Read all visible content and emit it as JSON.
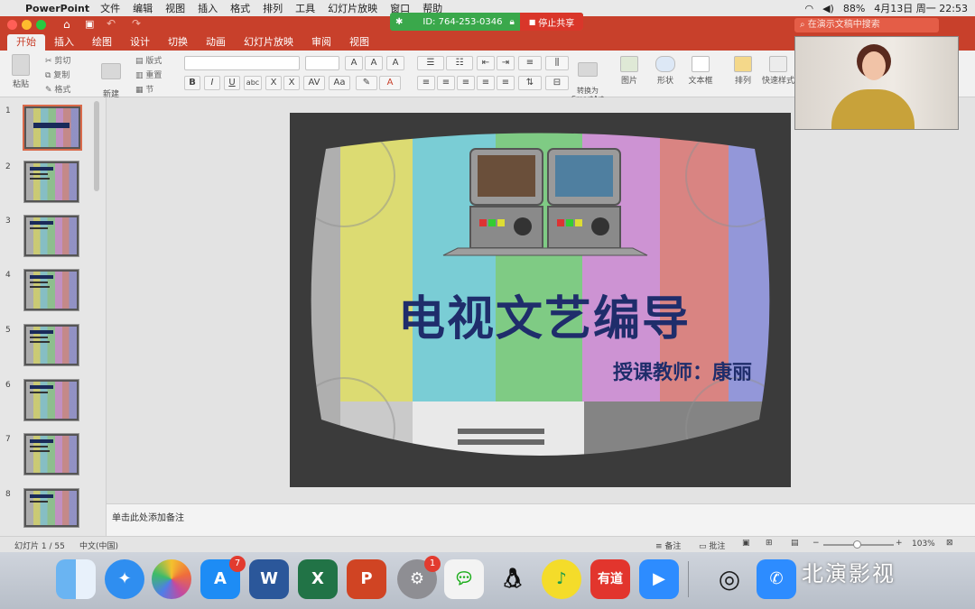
{
  "menubar": {
    "app_name": "PowerPoint",
    "items": [
      "文件",
      "编辑",
      "视图",
      "插入",
      "格式",
      "排列",
      "工具",
      "幻灯片放映",
      "窗口",
      "帮助"
    ],
    "battery": "88%",
    "datetime": "4月13日 周一  22:53"
  },
  "share": {
    "id": "ID: 764-253-0346",
    "stop_label": "停止共享"
  },
  "search": {
    "placeholder": "在演示文稿中搜索"
  },
  "ribbon_tabs": [
    "开始",
    "插入",
    "绘图",
    "设计",
    "切换",
    "动画",
    "幻灯片放映",
    "审阅",
    "视图"
  ],
  "ribbon": {
    "paste": "粘贴",
    "cut": "剪切",
    "copy": "复制",
    "format": "格式",
    "new_slide": "新建\n幻灯片",
    "layout": "版式",
    "reset": "重置",
    "section": "节",
    "convert_smartart": "转换为\nSmartArt",
    "picture": "图片",
    "shape": "形状",
    "textbox": "文本框",
    "arrange": "排列",
    "quick_styles": "快速样式"
  },
  "thumbnails": [
    "1",
    "2",
    "3",
    "4",
    "5",
    "6",
    "7",
    "8"
  ],
  "slide": {
    "title": "电视文艺编导",
    "subtitle": "授课教师：康丽"
  },
  "notes": {
    "placeholder": "单击此处添加备注"
  },
  "status": {
    "slide_counter": "幻灯片 1 / 55",
    "language": "中文(中国)",
    "notes_btn": "备注",
    "comments_btn": "批注",
    "zoom": "103%"
  },
  "dock": {
    "badge_appstore": "7",
    "badge_settings": "1",
    "word": "W",
    "excel": "X",
    "ppt": "P",
    "youdao": "有道"
  },
  "watermark": "北演影视",
  "colors": {
    "accent": "#c8402b",
    "share_green": "#3aa84b",
    "stop_red": "#d9362a",
    "title_navy": "#1f2d6b"
  }
}
